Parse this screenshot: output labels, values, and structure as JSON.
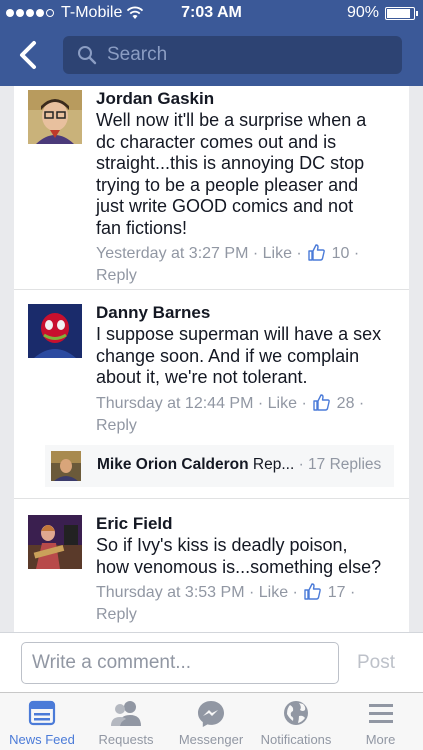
{
  "status_bar": {
    "carrier": "T-Mobile",
    "time": "7:03 AM",
    "battery": "90%",
    "battery_level": 0.9
  },
  "nav": {
    "search_placeholder": "Search"
  },
  "comments": [
    {
      "author": "Jordan Gaskin",
      "lines": [
        "Well now it'll be a surprise when a",
        "dc character comes out and is",
        "straight...this is annoying DC stop",
        "trying to be a people pleaser and",
        "just write GOOD comics and not",
        "fan fictions!"
      ],
      "timestamp": "Yesterday at 3:27 PM",
      "like_label": "Like",
      "likes": "10",
      "reply_label": "Reply"
    },
    {
      "author": "Danny Barnes",
      "lines": [
        "I suppose superman will have a sex",
        "change soon. And if we complain",
        "about it, we're not tolerant."
      ],
      "timestamp": "Thursday at 12:44 PM",
      "like_label": "Like",
      "likes": "28",
      "reply_label": "Reply"
    },
    {
      "author": "Eric Field",
      "lines": [
        "So if Ivy's kiss is deadly poison,",
        "how venomous is...something else?"
      ],
      "timestamp": "Thursday at 3:53 PM",
      "like_label": "Like",
      "likes": "17",
      "reply_label": "Reply"
    }
  ],
  "reply_preview": {
    "author": "Mike Orion Calderon",
    "snippet": "Rep...",
    "count": "17 Replies"
  },
  "composer": {
    "placeholder": "Write a comment...",
    "post_label": "Post"
  },
  "tabs": [
    {
      "label": "News Feed",
      "icon": "news-feed-icon",
      "active": true
    },
    {
      "label": "Requests",
      "icon": "friend-requests-icon",
      "active": false
    },
    {
      "label": "Messenger",
      "icon": "messenger-icon",
      "active": false
    },
    {
      "label": "Notifications",
      "icon": "globe-icon",
      "active": false
    },
    {
      "label": "More",
      "icon": "menu-icon",
      "active": false
    }
  ],
  "colors": {
    "brand": "#3b5998",
    "active_tab": "#4b7bd8",
    "meta_text": "#9197a3"
  }
}
